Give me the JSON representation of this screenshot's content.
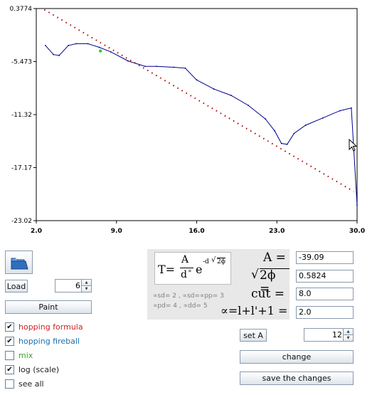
{
  "chart_data": {
    "type": "line",
    "x_ticks": [
      "2.0",
      "9.0",
      "16.0",
      "23.0",
      "30.0"
    ],
    "y_ticks": [
      "0.3774",
      "-5.473",
      "-11.32",
      "-17.17",
      "-23.02"
    ],
    "xlim": [
      2.0,
      30.0
    ],
    "ylim": [
      -23.02,
      0.3774
    ],
    "series": [
      {
        "style": "solid",
        "color": "#00008b",
        "points": [
          [
            2.8,
            -3.7
          ],
          [
            3.5,
            -4.7
          ],
          [
            4.0,
            -4.8
          ],
          [
            4.8,
            -3.7
          ],
          [
            5.5,
            -3.5
          ],
          [
            6.5,
            -3.5
          ],
          [
            7.5,
            -3.9
          ],
          [
            8.5,
            -4.4
          ],
          [
            10,
            -5.4
          ],
          [
            11.5,
            -6.0
          ],
          [
            12.5,
            -6.0
          ],
          [
            14,
            -6.1
          ],
          [
            15,
            -6.2
          ],
          [
            16,
            -7.5
          ],
          [
            17.5,
            -8.5
          ],
          [
            19,
            -9.2
          ],
          [
            20.5,
            -10.3
          ],
          [
            22,
            -11.8
          ],
          [
            22.8,
            -13.1
          ],
          [
            23.4,
            -14.5
          ],
          [
            23.9,
            -14.6
          ],
          [
            24.5,
            -13.4
          ],
          [
            25.5,
            -12.5
          ],
          [
            27,
            -11.7
          ],
          [
            28.5,
            -10.9
          ],
          [
            29.5,
            -10.6
          ],
          [
            30,
            -21.3
          ]
        ]
      },
      {
        "style": "dotted",
        "color": "#aa0000",
        "points": [
          [
            2.7,
            0.25
          ],
          [
            29.7,
            -19.8
          ]
        ]
      }
    ],
    "highlight_point": {
      "x": 7.6,
      "y": -4.3,
      "color": "#33cc33"
    }
  },
  "icons": {
    "open": "folder-open-icon",
    "cursor": "mouse-cursor-icon"
  },
  "controls": {
    "load_label": "Load",
    "load_value": "6",
    "paint_label": "Paint",
    "set_a_label": "set A",
    "set_a_value": "12",
    "change_label": "change",
    "save_label": "save the changes"
  },
  "checkboxes": [
    {
      "label": "hopping formula",
      "checked": true,
      "color": "#cc2222"
    },
    {
      "label": "hopping fireball",
      "checked": true,
      "color": "#1a6fb0"
    },
    {
      "label": "mix",
      "checked": false,
      "color": "#33aa22"
    },
    {
      "label": "log (scale)",
      "checked": true,
      "color": "#222222"
    },
    {
      "label": "see all",
      "checked": false,
      "color": "#222222"
    }
  ],
  "formula": {
    "T": "T=",
    "A": "A",
    "d": "d",
    "alpha": "∝",
    "e": "e",
    "exp_d": "-d",
    "phi": "2ϕ",
    "sub_line1": "∝sd= 2 , ∝sd=∝pp= 3",
    "sub_line2": "∝pd= 4 , ∝dd= 5"
  },
  "params": {
    "A_label": "A =",
    "A_value": "-39.09",
    "phi_label": "2ϕ =",
    "phi_value": "0.5824",
    "cut_label": "cut =",
    "cut_value": "8.0",
    "alpha_label": "∝=l+l'+1 =",
    "alpha_value": "2.0"
  }
}
